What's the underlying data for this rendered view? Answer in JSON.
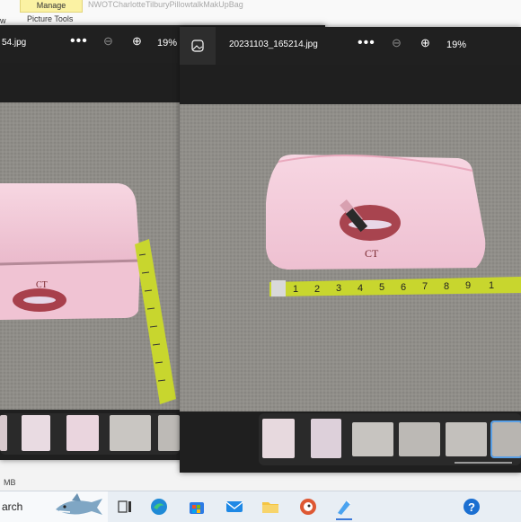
{
  "ribbon": {
    "manage_label": "Manage",
    "picture_tools_label": "Picture Tools",
    "document_title": "NWOTCharlotteTilburyPillowtalkMakUpBag",
    "left_fragment": "w"
  },
  "left_viewer": {
    "filename": "54.jpg",
    "more_glyph": "•••",
    "zoom_out_glyph": "⊖",
    "zoom_in_glyph": "⊕",
    "zoom_level": "19%"
  },
  "right_viewer": {
    "filename": "20231103_165214.jpg",
    "more_glyph": "•••",
    "zoom_out_glyph": "⊖",
    "zoom_in_glyph": "⊕",
    "zoom_level": "19%",
    "selected_thumbnail_index": 6
  },
  "status_bar": {
    "size_text": "MB"
  },
  "taskbar": {
    "search_text": "arch",
    "icons": [
      "shark-search-decoration-icon",
      "task-view-icon",
      "edge-icon",
      "store-icon",
      "mail-icon",
      "file-explorer-icon",
      "duckduckgo-icon",
      "paint-icon",
      "help-icon"
    ]
  },
  "colors": {
    "viewer_bg": "#1f1f1f",
    "bag_pink": "#f2c9d7",
    "tape_yellow": "#c8d62e",
    "carpet_gray": "#8f8d88",
    "accent_blue": "#3b78d8"
  }
}
